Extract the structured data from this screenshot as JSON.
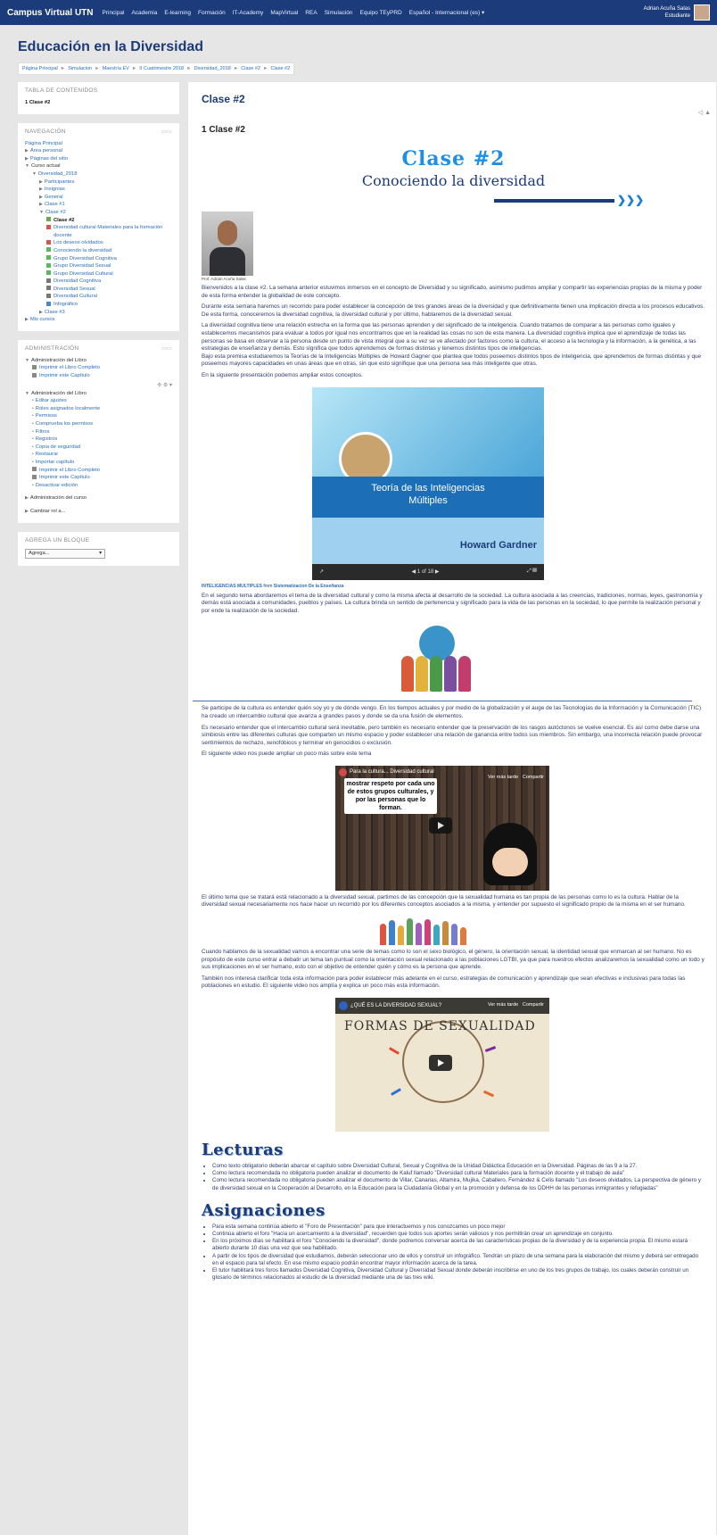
{
  "header": {
    "brand": "Campus Virtual UTN",
    "nav": [
      "Principal",
      "Academia",
      "E-learning",
      "Formación",
      "IT-Academy",
      "MapVirtual",
      "REA",
      "Simulación",
      "Equipo TEyPRD",
      "Español - Internacional (es) ▾"
    ],
    "user_name": "Adrian Acuña Salas",
    "user_role": "Estudiante"
  },
  "page_title": "Educación en la Diversidad",
  "breadcrumb": [
    "Página Principal",
    "Simulacion",
    "Maestría EV",
    "II Cuatrimestre 2018",
    "Diversidad_2018",
    "Clase #2",
    "Clase #2"
  ],
  "sidebar": {
    "toc_title": "TABLA DE CONTENIDOS",
    "toc_item": "1 Clase #2",
    "nav_title": "NAVEGACIÓN",
    "nav_items": [
      {
        "label": "Página Principal",
        "indent": 0,
        "kind": "link"
      },
      {
        "label": "Área personal",
        "indent": 0,
        "kind": "arrow"
      },
      {
        "label": "Páginas del sitio",
        "indent": 0,
        "kind": "arrow"
      },
      {
        "label": "Curso actual",
        "indent": 0,
        "kind": "open"
      },
      {
        "label": "Diversidad_2018",
        "indent": 1,
        "kind": "open"
      },
      {
        "label": "Participantes",
        "indent": 2,
        "kind": "arrow"
      },
      {
        "label": "Insignias",
        "indent": 2,
        "kind": "arrow"
      },
      {
        "label": "General",
        "indent": 2,
        "kind": "arrow"
      },
      {
        "label": "Clase #1",
        "indent": 2,
        "kind": "arrow"
      },
      {
        "label": "Clase #2",
        "indent": 2,
        "kind": "open"
      },
      {
        "label": "Clase #2",
        "indent": 3,
        "kind": "book"
      },
      {
        "label": "Diversidad cultural Materiales para la formación",
        "indent": 3,
        "kind": "pdf"
      },
      {
        "label": "docente",
        "indent": 4,
        "kind": "text"
      },
      {
        "label": "Los deseos olvidados",
        "indent": 3,
        "kind": "pdf"
      },
      {
        "label": "Conociendo la diversidad",
        "indent": 3,
        "kind": "forum"
      },
      {
        "label": "Grupo Diversidad Cognitiva",
        "indent": 3,
        "kind": "forum"
      },
      {
        "label": "Grupo Diversidad Sexual",
        "indent": 3,
        "kind": "forum"
      },
      {
        "label": "Grupo Diversidad Cultural",
        "indent": 3,
        "kind": "forum"
      },
      {
        "label": "Diversidad Cognitiva",
        "indent": 3,
        "kind": "wiki"
      },
      {
        "label": "Diversidad Sexual",
        "indent": 3,
        "kind": "wiki"
      },
      {
        "label": "Diversidad Cultural",
        "indent": 3,
        "kind": "wiki"
      },
      {
        "label": "Infográfico",
        "indent": 3,
        "kind": "assign"
      },
      {
        "label": "Clase #3",
        "indent": 2,
        "kind": "arrow"
      },
      {
        "label": "Mis cursos",
        "indent": 0,
        "kind": "arrow"
      }
    ],
    "admin_title": "ADMINISTRACIÓN",
    "admin_items": [
      {
        "label": "Administración del Libro",
        "indent": 0,
        "kind": "open"
      },
      {
        "label": "Imprimir el Libro Completo",
        "indent": 1,
        "kind": "print"
      },
      {
        "label": "Imprimir este Capítulo",
        "indent": 1,
        "kind": "print"
      }
    ],
    "admin_gear": "✣ ⚙ ▾",
    "admin_items2": [
      {
        "label": "Administración del Libro",
        "indent": 0,
        "kind": "open"
      },
      {
        "label": "Editar ajustes",
        "indent": 1,
        "kind": "bullet"
      },
      {
        "label": "Roles asignados localmente",
        "indent": 1,
        "kind": "bullet"
      },
      {
        "label": "Permisos",
        "indent": 1,
        "kind": "bullet"
      },
      {
        "label": "Comprueba los permisos",
        "indent": 1,
        "kind": "bullet"
      },
      {
        "label": "Filtros",
        "indent": 1,
        "kind": "bullet"
      },
      {
        "label": "Registros",
        "indent": 1,
        "kind": "bullet"
      },
      {
        "label": "Copia de seguridad",
        "indent": 1,
        "kind": "bullet"
      },
      {
        "label": "Restaurar",
        "indent": 1,
        "kind": "bullet"
      },
      {
        "label": "Importar capítulo",
        "indent": 1,
        "kind": "bullet"
      },
      {
        "label": "Imprimir el Libro Completo",
        "indent": 1,
        "kind": "print"
      },
      {
        "label": "Imprimir este Capítulo",
        "indent": 1,
        "kind": "print"
      },
      {
        "label": "Desactivar edición",
        "indent": 1,
        "kind": "bullet"
      }
    ],
    "admin_course": "Administración del curso",
    "switch_role": "Cambiar rol a...",
    "addblock_title": "AGREGA UN BLOQUE",
    "addblock_select": "Agrega..."
  },
  "main": {
    "title": "Clase #2",
    "chapter": "1 Clase #2",
    "tools": "◁ ▲",
    "banner_title": "Clase #2",
    "banner_sub": "Conociendo la diversidad",
    "photo_caption": "Prof. Adrián Acuña Salas",
    "p1": "Bienvenidos a la clase #2. La semana anterior estuvimos inmersos en el concepto de Diversidad y su significado, asimismo pudimos ampliar y compartir las experiencias propias de la misma y poder de esta forma entender la globalidad de este concepto.",
    "p2": "Durante esta semana haremos un recorrido para poder establecer la concepción de tres grandes áreas de la diversidad y que definitivamente tienen una implicación directa a los procesos educativos. De esta forma, conoceremos la diversidad cognitiva, la diversidad cultural y por último, hablaremos de la diversidad sexual.",
    "p3": "La diversidad cognitiva tiene una relación estrecha en la forma que las personas aprenden y del significado de la inteligencia. Cuando tratamos de comparar a las personas como iguales y establecemos mecanismos para evaluar a todos por igual nos encontramos que en la realidad las cosas no son de esta manera. La diversidad cognitiva implica que el aprendizaje de todas las personas se basa en observar a la persona desde un punto de vista integral que a su vez se ve afectado por factores como la cultura, el acceso a la tecnología y la información, a la genética, a las estrategias de enseñanza y demás. Esto significa que todos aprendemos de formas distintas y tenemos distintos tipos de inteligencias.",
    "p4": "Bajo esta premisa estudiaremos la Teorías de la Inteligencias Múltiples de Howard Gagner que plantea que todos poseemos distintos tipos de inteligencia, que aprendemos de formas distintas y que poseemos mayores capacidades en unas áreas que en otras, sin que esto signifique que una persona sea más inteligente que otras.",
    "p5": "En la siguiente presentación podemos ampliar estos conceptos.",
    "slide_line1": "Teoría de las Inteligencias",
    "slide_line2": "Múltiples",
    "slide_author": "Howard Gardner",
    "slide_counter": "◀  1 of 18  ▶",
    "credit_bold": "INTELIGENCIAS MULTIPLES",
    "credit_from": " from ",
    "credit_src": "Sistematizacion De la Enseñanza",
    "p6": "En el segundo tema abordaremos el tema de la diversidad cultural y como la misma afecta al desarrollo de la sociedad. La cultura asociada a las creencias, tradiciones, normas, leyes, gastronomía y demás está asociada a comunidades, pueblos y países. La cultura brinda un sentido de pertenencia y significado para la vida de las personas en la sociedad, lo que permite la realización personal y por ende la realización de la sociedad.",
    "p7": "Se participe de la cultura es entender quién soy yo y de dónde vengo. En los tiempos actuales y por medio de la globalización y el auge de las Tecnologías de la Información y la Comunicación (TIC) ha creado un intercambio cultural que avanza a grandes pasos y donde se da una fusión de elementos.",
    "p8": "Es necesario entender que el intercambio cultural será inevitable, pero también es necesario entender que la preservación de los rasgos autóctonos se vuelve esencial. Es así como debe darse una simbiosis entre las diferentes culturas que comparten un mismo espacio y poder establecer una relación de ganancia entre todos sus miembros. Sin embargo, una incorrecta relación puede provocar sentimientos de rechazo, xenofóbicos y terminar en genocidios o exclusión.",
    "p9": "El siguiente video nos puede ampliar un poco más sobre este tema",
    "video1_title": "Para la cultura... Diversidad cultural",
    "video1_overlay": "mostrar respeto por cada uno de estos grupos culturales, y por las personas que lo forman.",
    "video_later": "Ver más tarde",
    "video_share": "Compartir",
    "p10": "El último tema que se tratará está relacionado a la diversidad sexual, partimos de las concepción que la sexualidad humana es tan propia de las personas como lo es la cultura. Hablar de la diversidad sexual necesariamente nos hace hacer un recorrido por los diferentes conceptos asociados a la misma, y entender por supuesto el significado propio de la misma en el ser humano.",
    "p11": "Cuando hablamos de la sexualidad vamos a encontrar una serie de temas como lo son el sexo biológico, el género, la orientación sexual, la identidad sexual que enmarcan al ser humano. No es propósito de este curso entrar a debatir un tema tan puntual como la orientación sexual relacionado a las poblaciones LGTBI, ya que para nuestros efectos analizaremos la sexualidad como un todo y sus implicaciones en el ser humano, esto con el objetivo de entender quién y cómo es la persona que aprende.",
    "p12": "También nos interesa clarificar toda esta información para poder establecer más adelante en el curso, estrategias de comunicación y aprendizaje que sean efectivas e inclusivas para todas las poblaciones en estudio. El siguiente video nos amplía y explica un poco más esta información.",
    "video2_title": "¿QUÉ ES LA DIVERSIDAD SEXUAL?",
    "video2_text": "FORMAS DE SEXUALIDAD",
    "lecturas_title": "Lecturas",
    "lecturas": [
      "Como texto obligatorio deberán abarcar el capítulo sobre Diversidad Cultural, Sexual y Cognitiva de la Unidad Didáctica Educación en la Diversidad. Páginas de las 9 a la 27.",
      "Como lectura recomendada no obligatoria pueden analizar el documento de Kaluf llamado \"Diversidad cultural Materiales para la formación docente y el trabajo de aula\"",
      "Como lectura recomendada no obligatoria pueden analizar el documento de Villar, Canarias, Altamira, Mujika, Caballero, Fernández & Celis llamado \"Los deseos olvidados, La perspectiva de género y de diversidad sexual en la Cooperación al Desarrollo, en la Educación para la Ciudadanía Global y en la promoción y defensa de los DDHH de las personas inmigrantes y refugiadas\""
    ],
    "asignaciones_title": "Asignaciones",
    "asignaciones": [
      "Para esta semana continúa abierto el \"Foro de Presentación\" para que interactuemos y nos conozcamos un poco mejor",
      "Continúa abierto el foro \"Hacia un acercamiento a la diversidad\", recuerden que todos sus aportes serán valiosos y nos permitirán crear un aprendizaje en conjunto.",
      "En los próximos días se habilitará el foro \"Conociendo la diversidad\", donde podremos conversar acerca de las características propias de la diversidad y de la experiencia propia. El mismo estará abierto durante 10 días una vez que sea habilitado.",
      "A partir de los tipos de diversidad que estudiamos, deberán seleccionar uno de ellos y construir un infográfico. Tendrán un plazo de una semana para la elaboración del mismo y deberá ser entregado en el espacio para tal efecto. En ese mismo espacio podrán encontrar mayor información acerca de la tarea.",
      "El tutor habilitará tres foros llamados Diversidad Cognitiva, Diversidad Cultural y Diversidad Sexual donde deberán inscribirse en uno de los tres grupos de trabajo, los cuales deberán construir un glosario de términos relacionados al estudio de la diversidad mediante una de las tres wiki."
    ]
  },
  "colors": {
    "topbar": "#1c3b7a",
    "link": "#2a6ebb",
    "accent": "#1d8fe6"
  }
}
